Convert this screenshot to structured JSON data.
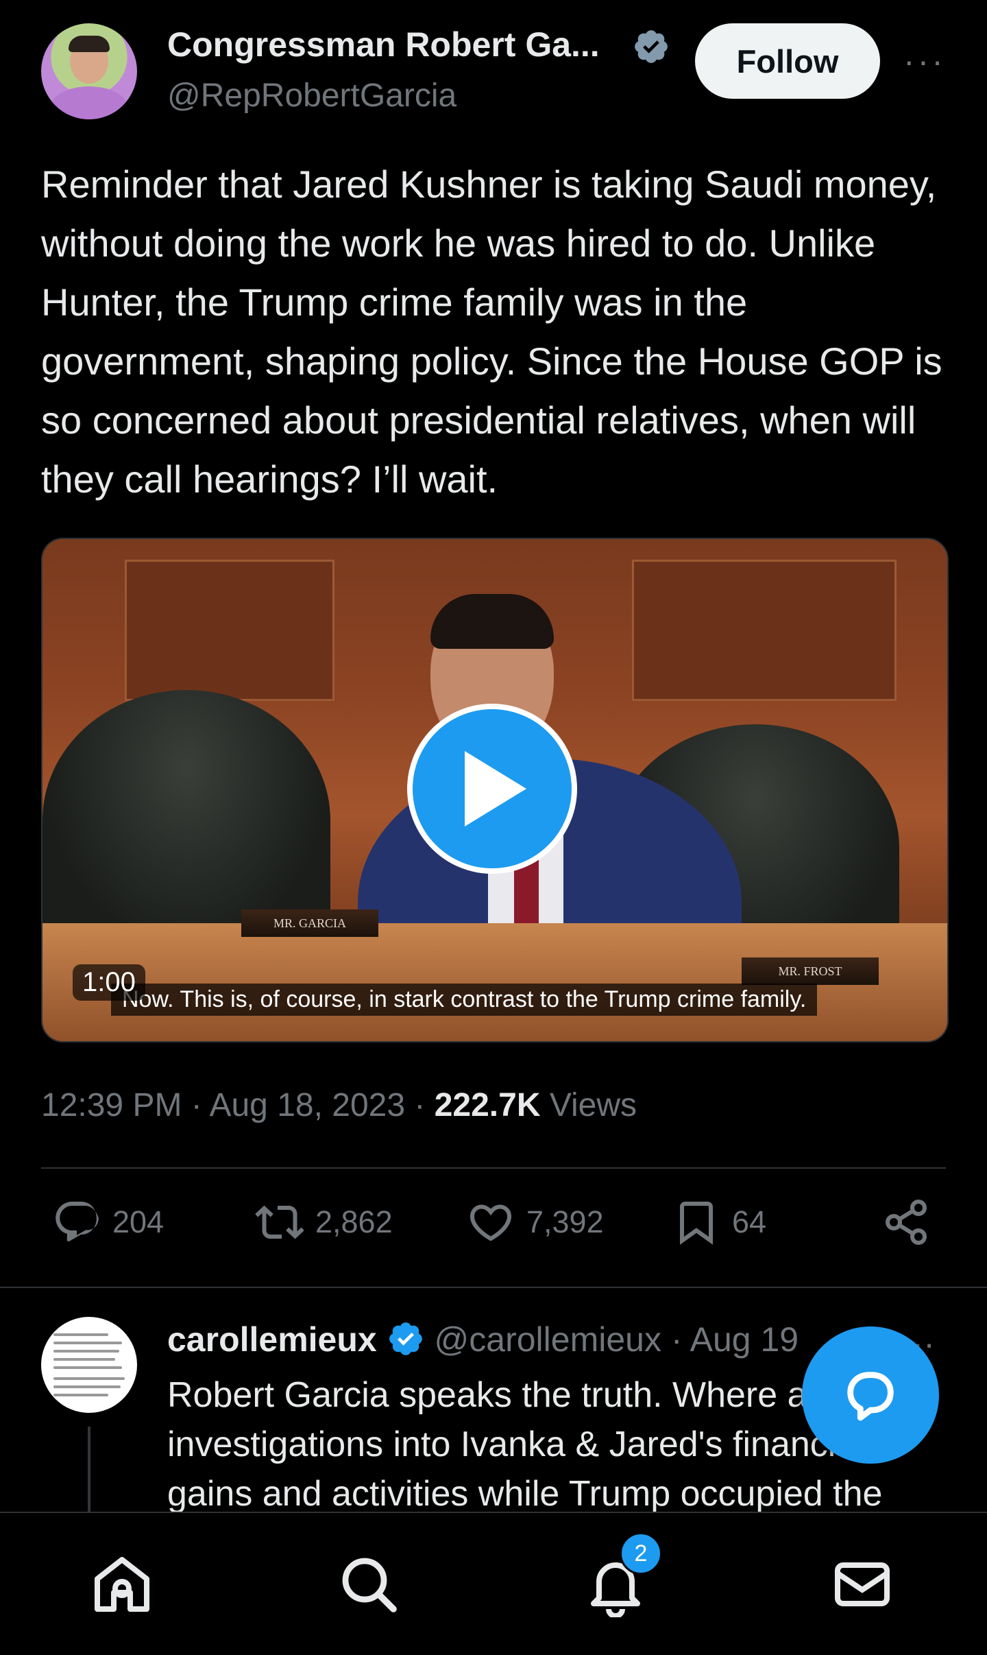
{
  "author": {
    "display_name": "Congressman Robert Ga...",
    "handle": "@RepRobertGarcia",
    "verified": true
  },
  "follow_label": "Follow",
  "more_label": "···",
  "tweet_text": "Reminder that Jared Kushner is taking Saudi money, without doing the work he was hired to do. Unlike Hunter, the Trump crime family was in the government, shaping policy. Since the House GOP is so concerned about presidential relatives, when will they call hearings? I’ll wait.",
  "media": {
    "duration": "1:00",
    "caption": "Now. This is, of course, in stark contrast to the Trump crime family.",
    "nameplate_left": "MR. GARCIA",
    "nameplate_right": "MR. FROST"
  },
  "meta": {
    "time_date": "12:39 PM · Aug 18, 2023 · ",
    "views_count": "222.7K",
    "views_label": " Views"
  },
  "actions": {
    "replies": "204",
    "reposts": "2,862",
    "likes": "7,392",
    "bookmarks": "64"
  },
  "reply": {
    "name": "carollemieux",
    "handle_time": "@carollemieux · Aug 19",
    "text": "Robert Garcia speaks the truth.  Where are investigations into Ivanka & Jared's financial gains and activities while Trump occupied the"
  },
  "notifications_count": "2",
  "colors": {
    "accent": "#1d9bf0",
    "background": "#000000",
    "text_primary": "#e7e9ea",
    "text_secondary": "#71767b"
  },
  "icons": [
    "verified-badge-icon",
    "more-icon",
    "play-icon",
    "reply-icon",
    "repost-icon",
    "like-icon",
    "bookmark-icon",
    "share-icon",
    "compose-reply-icon",
    "home-icon",
    "search-icon",
    "notifications-icon",
    "messages-icon"
  ]
}
